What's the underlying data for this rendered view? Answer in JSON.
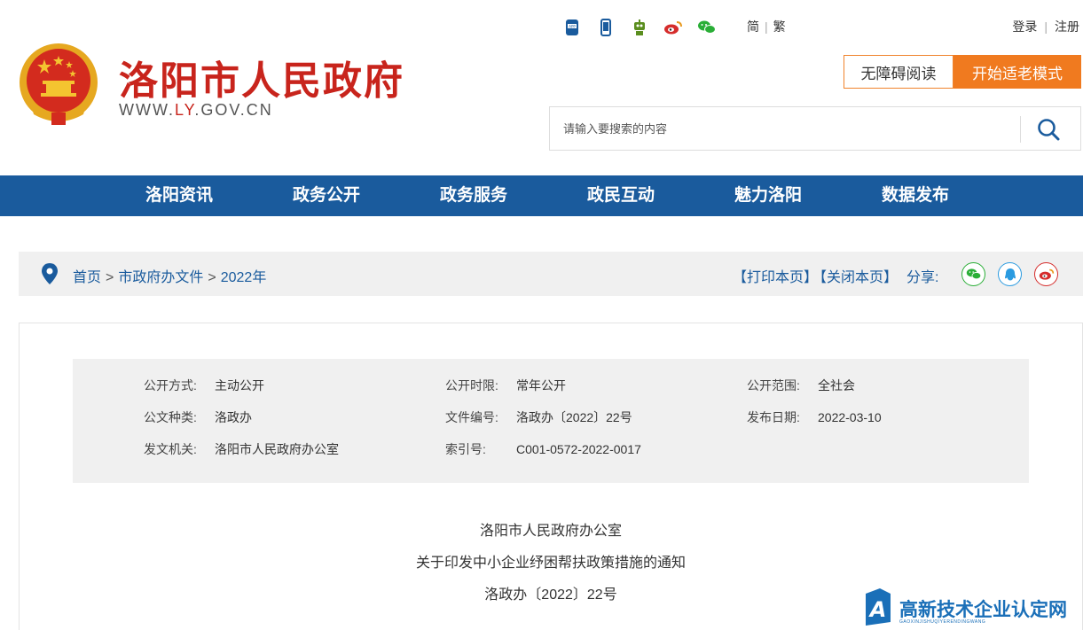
{
  "header": {
    "site_title": "洛阳市人民政府",
    "url_prefix": "WWW.",
    "url_highlight": "LY",
    "url_suffix": ".GOV.CN",
    "lang_simplified": "简",
    "lang_traditional": "繁",
    "login": "登录",
    "register": "注册",
    "accessible_reading": "无障碍阅读",
    "elder_mode": "开始适老模式",
    "search_placeholder": "请输入要搜索的内容",
    "top_icons": [
      "app-icon",
      "mobile-icon",
      "robot-icon",
      "weibo-icon",
      "wechat-icon"
    ]
  },
  "nav": {
    "items": [
      "洛阳资讯",
      "政务公开",
      "政务服务",
      "政民互动",
      "魅力洛阳",
      "数据发布"
    ]
  },
  "breadcrumb": {
    "items": [
      "首页",
      "市政府办文件",
      "2022年"
    ],
    "separator": ">",
    "print": "【打印本页】",
    "close": "【关闭本页】",
    "share_label": "分享:"
  },
  "meta": {
    "disclosure_method_label": "公开方式:",
    "disclosure_method": "主动公开",
    "disclosure_period_label": "公开时限:",
    "disclosure_period": "常年公开",
    "disclosure_scope_label": "公开范围:",
    "disclosure_scope": "全社会",
    "doc_type_label": "公文种类:",
    "doc_type": "洛政办",
    "doc_number_label": "文件编号:",
    "doc_number": "洛政办〔2022〕22号",
    "publish_date_label": "发布日期:",
    "publish_date": "2022-03-10",
    "issuer_label": "发文机关:",
    "issuer": "洛阳市人民政府办公室",
    "index_label": "索引号:",
    "index": "C001-0572-2022-0017"
  },
  "document": {
    "line1": "洛阳市人民政府办公室",
    "line2": "关于印发中小企业纾困帮扶政策措施的通知",
    "line3": "洛政办〔2022〕22号"
  },
  "watermark": {
    "title": "高新技术企业认定网",
    "subtitle": "GAOXINJISHUQIYERENDINGWANG"
  },
  "colors": {
    "brand_red": "#c8241c",
    "nav_blue": "#1a5b9d",
    "accent_orange": "#f07a1f"
  }
}
